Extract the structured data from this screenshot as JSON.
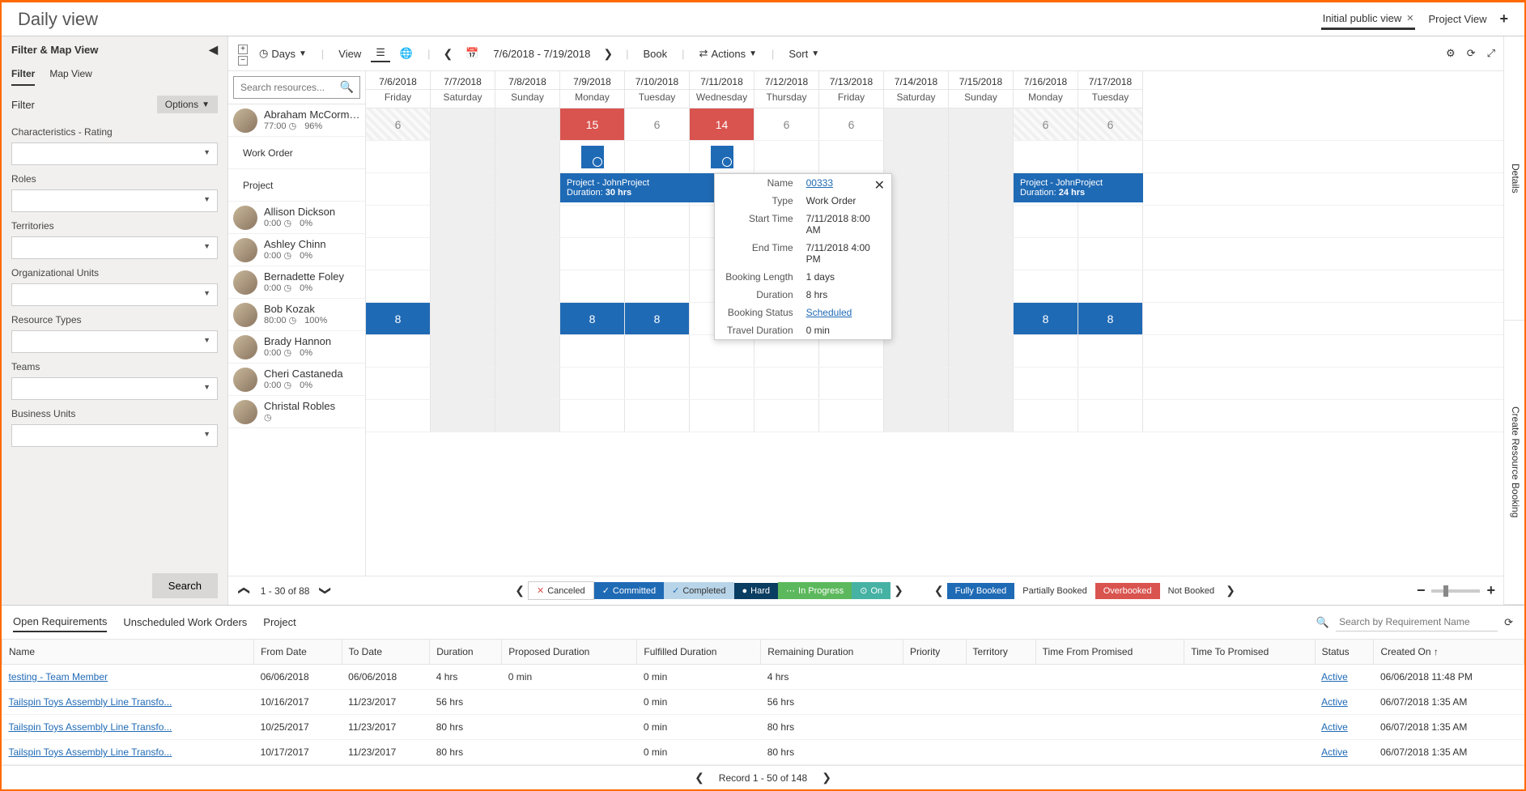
{
  "title": "Daily view",
  "viewTabs": {
    "active": "Initial public view",
    "other": "Project View"
  },
  "sidebar": {
    "title": "Filter & Map View",
    "tabs": [
      "Filter",
      "Map View"
    ],
    "filterLabel": "Filter",
    "optionsLabel": "Options",
    "groups": [
      "Characteristics - Rating",
      "Roles",
      "Territories",
      "Organizational Units",
      "Resource Types",
      "Teams",
      "Business Units"
    ],
    "searchBtn": "Search"
  },
  "toolbar": {
    "days": "Days",
    "view": "View",
    "dateRange": "7/6/2018 - 7/19/2018",
    "book": "Book",
    "actions": "Actions",
    "sort": "Sort"
  },
  "searchPlaceholder": "Search resources...",
  "days": [
    {
      "date": "7/6/2018",
      "name": "Friday"
    },
    {
      "date": "7/7/2018",
      "name": "Saturday"
    },
    {
      "date": "7/8/2018",
      "name": "Sunday"
    },
    {
      "date": "7/9/2018",
      "name": "Monday"
    },
    {
      "date": "7/10/2018",
      "name": "Tuesday"
    },
    {
      "date": "7/11/2018",
      "name": "Wednesday"
    },
    {
      "date": "7/12/2018",
      "name": "Thursday"
    },
    {
      "date": "7/13/2018",
      "name": "Friday"
    },
    {
      "date": "7/14/2018",
      "name": "Saturday"
    },
    {
      "date": "7/15/2018",
      "name": "Sunday"
    },
    {
      "date": "7/16/2018",
      "name": "Monday"
    },
    {
      "date": "7/17/2018",
      "name": "Tuesday"
    }
  ],
  "resources": [
    {
      "name": "Abraham McCormi...",
      "hours": "77:00",
      "pct": "96%",
      "expanded": true
    },
    {
      "name": "Allison Dickson",
      "hours": "0:00",
      "pct": "0%"
    },
    {
      "name": "Ashley Chinn",
      "hours": "0:00",
      "pct": "0%"
    },
    {
      "name": "Bernadette Foley",
      "hours": "0:00",
      "pct": "0%"
    },
    {
      "name": "Bob Kozak",
      "hours": "80:00",
      "pct": "100%"
    },
    {
      "name": "Brady Hannon",
      "hours": "0:00",
      "pct": "0%"
    },
    {
      "name": "Cheri Castaneda",
      "hours": "0:00",
      "pct": "0%"
    },
    {
      "name": "Christal Robles",
      "hours": "",
      "pct": ""
    }
  ],
  "subRows": [
    "Work Order",
    "Project"
  ],
  "abrahamCells": [
    "6",
    "",
    "",
    "15",
    "6",
    "14",
    "6",
    "6",
    "",
    "",
    "6",
    "6"
  ],
  "bobCells": [
    "8",
    "",
    "",
    "8",
    "8",
    "",
    "",
    "",
    "",
    "",
    "8",
    "8"
  ],
  "projBar1": {
    "title": "Project - JohnProject",
    "dur": "Duration: ",
    "hrs": "30 hrs"
  },
  "projBar2": {
    "title": "Project - JohnProject",
    "dur": "Duration: ",
    "hrs": "24 hrs"
  },
  "tooltip": {
    "rows": [
      [
        "Name",
        "00333",
        true
      ],
      [
        "Type",
        "Work Order",
        false
      ],
      [
        "Start Time",
        "7/11/2018 8:00 AM",
        false
      ],
      [
        "End Time",
        "7/11/2018 4:00 PM",
        false
      ],
      [
        "Booking Length",
        "1 days",
        false
      ],
      [
        "Duration",
        "8 hrs",
        false
      ],
      [
        "Booking Status",
        "Scheduled",
        true
      ],
      [
        "Travel Duration",
        "0 min",
        false
      ]
    ]
  },
  "pager": "1 - 30 of 88",
  "legend": [
    "Canceled",
    "Committed",
    "Completed",
    "Hard",
    "In Progress",
    "On"
  ],
  "bookLegend": [
    "Fully Booked",
    "Partially Booked",
    "Overbooked",
    "Not Booked"
  ],
  "rails": [
    "Details",
    "Create Resource Booking"
  ],
  "bottomTabs": [
    "Open Requirements",
    "Unscheduled Work Orders",
    "Project"
  ],
  "bottomSearchPlaceholder": "Search by Requirement Name",
  "reqCols": [
    "Name",
    "From Date",
    "To Date",
    "Duration",
    "Proposed Duration",
    "Fulfilled Duration",
    "Remaining Duration",
    "Priority",
    "Territory",
    "Time From Promised",
    "Time To Promised",
    "Status",
    "Created On"
  ],
  "reqRows": [
    {
      "name": "testing - Team Member",
      "from": "06/06/2018",
      "to": "06/06/2018",
      "dur": "4 hrs",
      "prop": "0 min",
      "ful": "0 min",
      "rem": "4 hrs",
      "status": "Active",
      "created": "06/06/2018 11:48 PM"
    },
    {
      "name": "Tailspin Toys Assembly Line Transfo...",
      "from": "10/16/2017",
      "to": "11/23/2017",
      "dur": "56 hrs",
      "prop": "",
      "ful": "0 min",
      "rem": "56 hrs",
      "status": "Active",
      "created": "06/07/2018 1:35 AM"
    },
    {
      "name": "Tailspin Toys Assembly Line Transfo...",
      "from": "10/25/2017",
      "to": "11/23/2017",
      "dur": "80 hrs",
      "prop": "",
      "ful": "0 min",
      "rem": "80 hrs",
      "status": "Active",
      "created": "06/07/2018 1:35 AM"
    },
    {
      "name": "Tailspin Toys Assembly Line Transfo...",
      "from": "10/17/2017",
      "to": "11/23/2017",
      "dur": "80 hrs",
      "prop": "",
      "ful": "0 min",
      "rem": "80 hrs",
      "status": "Active",
      "created": "06/07/2018 1:35 AM"
    }
  ],
  "bottomPager": "Record 1 - 50 of 148"
}
